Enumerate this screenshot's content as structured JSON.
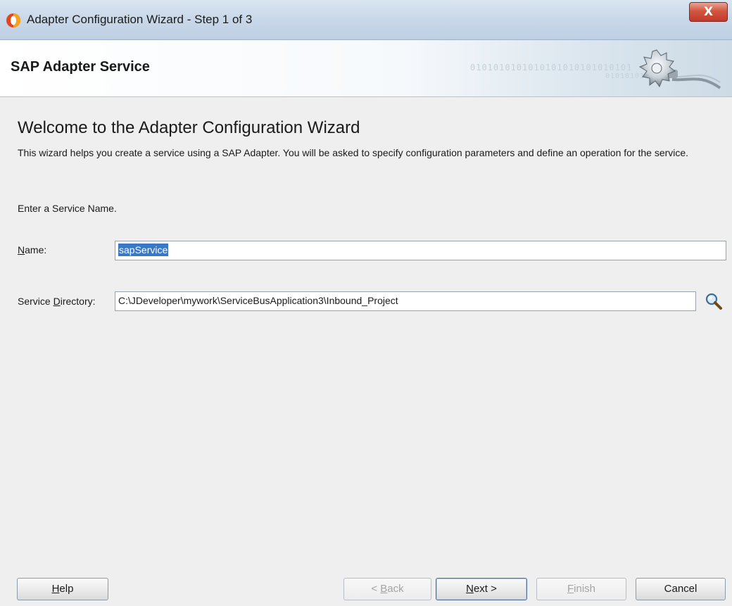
{
  "window": {
    "title": "Adapter Configuration Wizard - Step 1 of 3",
    "close_label": "X"
  },
  "header": {
    "service_title": "SAP Adapter Service",
    "binary_text_1": "0101010101010101010101010101",
    "binary_text_2": "01010101010"
  },
  "main": {
    "welcome_heading": "Welcome to the Adapter Configuration Wizard",
    "description": "This wizard helps you create a service using a SAP Adapter. You will be asked to specify configuration parameters and define an operation for the service.",
    "prompt": "Enter a Service Name.",
    "name_label_mnemonic": "N",
    "name_label_rest": "ame:",
    "name_value": "sapService",
    "dir_label_prefix": "Service ",
    "dir_label_mnemonic": "D",
    "dir_label_rest": "irectory:",
    "dir_value": "C:\\JDeveloper\\mywork\\ServiceBusApplication3\\Inbound_Project"
  },
  "buttons": {
    "help_mnemonic": "H",
    "help_rest": "elp",
    "back_prefix": "< ",
    "back_mnemonic": "B",
    "back_rest": "ack",
    "next_mnemonic": "N",
    "next_rest": "ext >",
    "finish_mnemonic": "F",
    "finish_rest": "inish",
    "cancel_label": "Cancel"
  },
  "colors": {
    "accent_selection": "#3a78c6",
    "close_button": "#c0392b",
    "dialog_background": "#efefef"
  },
  "icons": {
    "app": "oracle-jdeveloper-icon",
    "header": "gear-plug-icon",
    "browse": "magnifier-search-icon"
  }
}
